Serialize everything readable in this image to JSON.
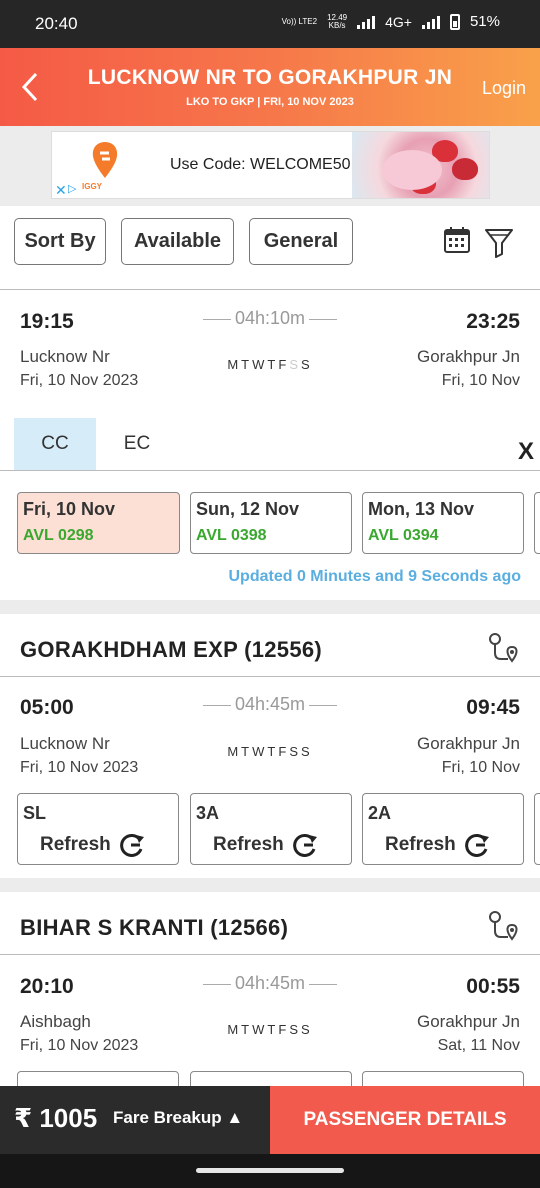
{
  "status": {
    "time": "20:40",
    "volte": "Vo)) LTE2",
    "speed_value": "12.49",
    "speed_unit": "KB/s",
    "network": "4G+",
    "battery": "51%"
  },
  "header": {
    "title": "LUCKNOW NR TO GORAKHPUR JN",
    "subtitle": "LKO TO GKP | FRI, 10 NOV  2023",
    "login": "Login"
  },
  "ad": {
    "brand": "IGGY",
    "text": "Use Code: WELCOME50"
  },
  "filters": {
    "sort": "Sort By",
    "available": "Available",
    "quota": "General"
  },
  "trains": [
    {
      "dep_time": "19:15",
      "arr_time": "23:25",
      "duration": "04h:10m",
      "from": "Lucknow Nr",
      "to": "Gorakhpur Jn",
      "dep_date": "Fri, 10 Nov  2023",
      "arr_date": "Fri, 10 Nov",
      "days": [
        {
          "d": "M",
          "on": true
        },
        {
          "d": "T",
          "on": true
        },
        {
          "d": "W",
          "on": true
        },
        {
          "d": "T",
          "on": true
        },
        {
          "d": "F",
          "on": true
        },
        {
          "d": "S",
          "on": false
        },
        {
          "d": "S",
          "on": true
        }
      ],
      "classes": [
        "CC",
        "EC"
      ],
      "close": "X",
      "availability": [
        {
          "date": "Fri, 10 Nov",
          "status": "AVL 0298"
        },
        {
          "date": "Sun, 12 Nov",
          "status": "AVL 0398"
        },
        {
          "date": "Mon, 13 Nov",
          "status": "AVL 0394"
        }
      ],
      "updated": "Updated 0 Minutes and 9 Seconds ago"
    },
    {
      "name": "GORAKHDHAM EXP (12556)",
      "dep_time": "05:00",
      "arr_time": "09:45",
      "duration": "04h:45m",
      "from": "Lucknow Nr",
      "to": "Gorakhpur Jn",
      "dep_date": "Fri, 10 Nov  2023",
      "arr_date": "Fri, 10 Nov",
      "days": [
        {
          "d": "M",
          "on": true
        },
        {
          "d": "T",
          "on": true
        },
        {
          "d": "W",
          "on": true
        },
        {
          "d": "T",
          "on": true
        },
        {
          "d": "F",
          "on": true
        },
        {
          "d": "S",
          "on": true
        },
        {
          "d": "S",
          "on": true
        }
      ],
      "classes": [
        {
          "name": "SL",
          "action": "Refresh"
        },
        {
          "name": "3A",
          "action": "Refresh"
        },
        {
          "name": "2A",
          "action": "Refresh"
        }
      ]
    },
    {
      "name": "BIHAR S KRANTI (12566)",
      "dep_time": "20:10",
      "arr_time": "00:55",
      "duration": "04h:45m",
      "from": "Aishbagh",
      "to": "Gorakhpur Jn",
      "dep_date": "Fri, 10 Nov  2023",
      "arr_date": "Sat, 11 Nov",
      "days": [
        {
          "d": "M",
          "on": true
        },
        {
          "d": "T",
          "on": true
        },
        {
          "d": "W",
          "on": true
        },
        {
          "d": "T",
          "on": true
        },
        {
          "d": "F",
          "on": true
        },
        {
          "d": "S",
          "on": true
        },
        {
          "d": "S",
          "on": true
        }
      ]
    }
  ],
  "bottom": {
    "fare": "₹ 1005",
    "fare_breakup": "Fare Breakup ▲",
    "cta": "PASSENGER DETAILS"
  },
  "colors": {
    "header_start": "#f55a46",
    "header_end": "#f9a14a",
    "cta": "#f15a4d",
    "available": "#3aa82f",
    "updated": "#5aaee0"
  }
}
